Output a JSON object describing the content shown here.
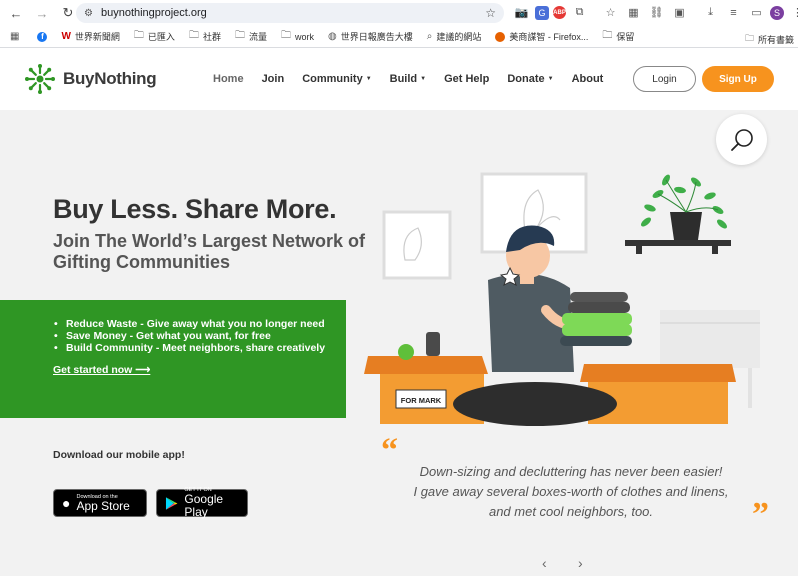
{
  "browser": {
    "url": "buynothingproject.org",
    "bookmarks": [
      {
        "label": "",
        "icon": "facebook-icon"
      },
      {
        "label": "世界新聞網",
        "icon": "worldjournal-icon"
      },
      {
        "label": "已匯入",
        "icon": "folder-icon"
      },
      {
        "label": "社群",
        "icon": "folder-icon"
      },
      {
        "label": "流量",
        "icon": "folder-icon"
      },
      {
        "label": "work",
        "icon": "folder-icon"
      },
      {
        "label": "世界日報廣告大樓",
        "icon": "globe-icon"
      },
      {
        "label": "建議的網站",
        "icon": "search-icon"
      },
      {
        "label": "美商謀智 - Firefox...",
        "icon": "firefox-icon"
      },
      {
        "label": "保留",
        "icon": "folder-icon"
      }
    ],
    "all_bookmarks_label": "所有書籤",
    "profile_initial": "S"
  },
  "site": {
    "brand": "BuyNothing",
    "brand_color": "#2f9624",
    "accent_color": "#f7931e",
    "nav": [
      {
        "label": "Home",
        "dropdown": false,
        "active": true
      },
      {
        "label": "Join",
        "dropdown": false,
        "active": false
      },
      {
        "label": "Community",
        "dropdown": true,
        "active": false
      },
      {
        "label": "Build",
        "dropdown": true,
        "active": false
      },
      {
        "label": "Get Help",
        "dropdown": false,
        "active": false
      },
      {
        "label": "Donate",
        "dropdown": true,
        "active": false
      },
      {
        "label": "About",
        "dropdown": false,
        "active": false
      }
    ],
    "login_label": "Login",
    "signup_label": "Sign Up"
  },
  "hero": {
    "headline": "Buy Less. Share More.",
    "subheadline": "Join The World’s Largest Network of Gifting Communities",
    "bullets": [
      "Reduce Waste - Give away what you no longer need",
      "Save Money - Get what you want, for free",
      "Build Community - Meet neighbors, share creatively"
    ],
    "cta": "Get started now ⟶",
    "box_label": "FOR MARK"
  },
  "app": {
    "download_label": "Download our mobile app!",
    "appstore_small": "Download on the",
    "appstore_big": "App Store",
    "googleplay_small": "GET IT ON",
    "googleplay_big": "Google Play"
  },
  "testimonial": {
    "lines": [
      "Down-sizing and decluttering has never been easier!",
      "I gave away several boxes-worth of clothes and linens,",
      "and met cool neighbors, too."
    ]
  }
}
